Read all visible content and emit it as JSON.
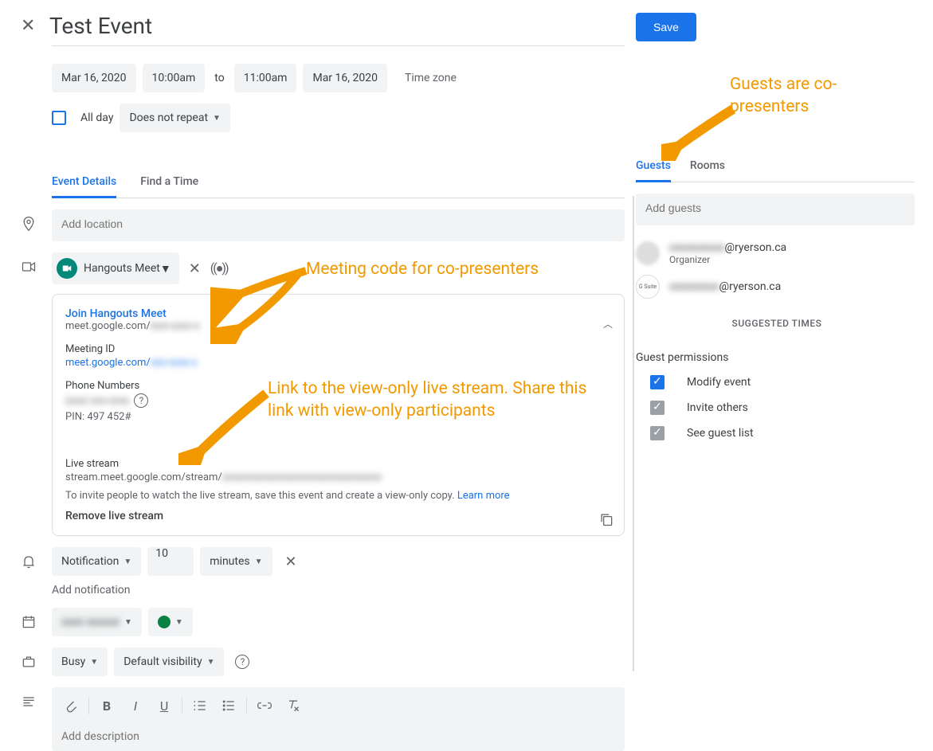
{
  "event": {
    "title": "Test Event",
    "start_date": "Mar 16, 2020",
    "start_time": "10:00am",
    "to_label": "to",
    "end_time": "11:00am",
    "end_date": "Mar 16, 2020",
    "timezone_label": "Time zone",
    "all_day_label": "All day",
    "repeat_label": "Does not repeat"
  },
  "tabs": {
    "details": "Event Details",
    "find_time": "Find a Time"
  },
  "location": {
    "placeholder": "Add location"
  },
  "conferencing": {
    "provider_label": "Hangouts Meet",
    "join_label": "Join Hangouts Meet",
    "join_url_prefix": "meet.google.com/",
    "join_url_code": "ixxx-xxxx-x",
    "meeting_id_label": "Meeting ID",
    "meeting_id_prefix": "meet.google.com/",
    "meeting_id_code": "xxx-xxxx-x",
    "phone_label": "Phone Numbers",
    "phone_number": "(xxx) xxx-xxxx",
    "pin_label": "PIN: 497 452#",
    "livestream_label": "Live stream",
    "livestream_url_prefix": "stream.meet.google.com/stream/",
    "livestream_url_code": "xxxxxxxxxxxxxxxxxxxxxxxxxxxxxxx",
    "livestream_info": "To invite people to watch the live stream, save this event and create a view-only copy. ",
    "learn_more": "Learn more",
    "remove_label": "Remove live stream"
  },
  "notification": {
    "type_label": "Notification",
    "value": "10",
    "unit_label": "minutes",
    "add_label": "Add notification"
  },
  "calendar": {
    "name": "xxxx xxxxxx"
  },
  "visibility": {
    "busy_label": "Busy",
    "visibility_label": "Default visibility"
  },
  "description": {
    "placeholder": "Add description"
  },
  "save_label": "Save",
  "right_tabs": {
    "guests": "Guests",
    "rooms": "Rooms"
  },
  "guests": {
    "placeholder": "Add guests",
    "list": [
      {
        "name": "xxxxxxxxxx",
        "domain": "@ryerson.ca",
        "sub": "Organizer"
      },
      {
        "name": "xxxxxxxxx",
        "domain": "@ryerson.ca",
        "sub": ""
      }
    ],
    "suggested_label": "SUGGESTED TIMES",
    "permissions_title": "Guest permissions",
    "perm_modify": "Modify event",
    "perm_invite": "Invite others",
    "perm_see": "See guest list"
  },
  "annotations": {
    "a1": "Meeting code for co-presenters",
    "a2": "Link to the view-only live stream. Share this link with view-only participants",
    "a3": "Guests are co-presenters"
  }
}
